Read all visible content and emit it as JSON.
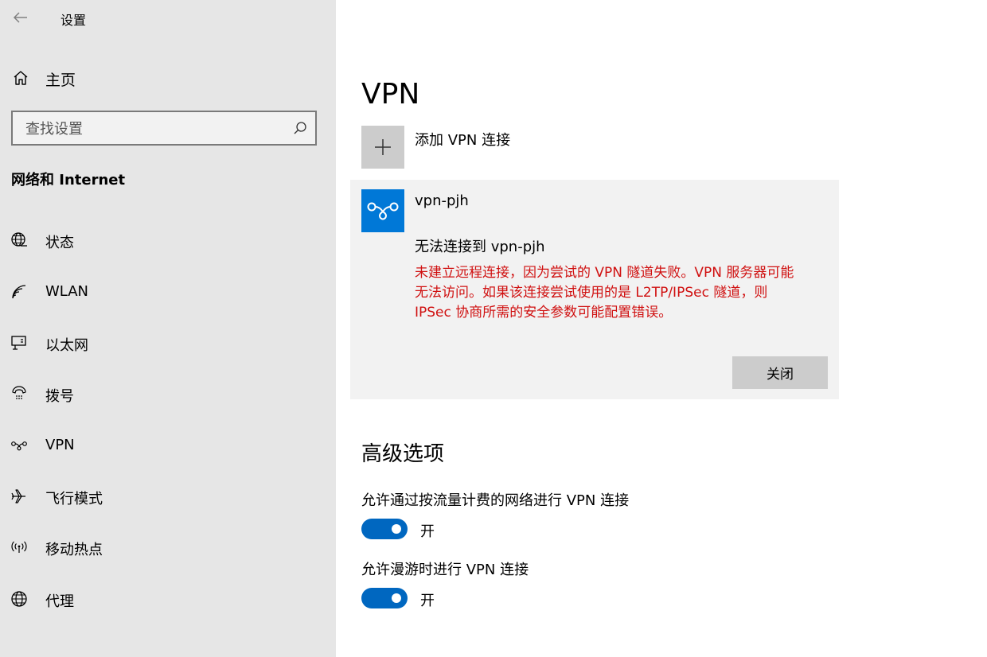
{
  "app": {
    "title": "设置"
  },
  "sidebar": {
    "home_label": "主页",
    "search_placeholder": "查找设置",
    "section_title": "网络和 Internet",
    "items": [
      {
        "label": "状态",
        "icon": "globe-status-icon"
      },
      {
        "label": "WLAN",
        "icon": "wifi-icon"
      },
      {
        "label": "以太网",
        "icon": "ethernet-icon"
      },
      {
        "label": "拨号",
        "icon": "dialup-icon"
      },
      {
        "label": "VPN",
        "icon": "vpn-icon"
      },
      {
        "label": "飞行模式",
        "icon": "airplane-icon"
      },
      {
        "label": "移动热点",
        "icon": "hotspot-icon"
      },
      {
        "label": "代理",
        "icon": "globe-icon"
      }
    ]
  },
  "main": {
    "title": "VPN",
    "add_vpn_label": "添加 VPN 连接",
    "vpn": {
      "name": "vpn-pjh",
      "status": "无法连接到 vpn-pjh",
      "error_lines": [
        "未建立远程连接，因为尝试的 VPN 隧道失败。VPN 服务器可能",
        "无法访问。如果该连接尝试使用的是 L2TP/IPSec 隧道，则",
        "IPSec 协商所需的安全参数可能配置错误。"
      ],
      "close_label": "关闭"
    },
    "advanced": {
      "title": "高级选项",
      "options": [
        {
          "label": "允许通过按流量计费的网络进行 VPN 连接",
          "state": "开",
          "on": true
        },
        {
          "label": "允许漫游时进行 VPN 连接",
          "state": "开",
          "on": true
        }
      ]
    }
  },
  "colors": {
    "sidebar_bg": "#e6e6e6",
    "accent": "#0067c0",
    "vpn_logo": "#0078d7",
    "error": "#d01010",
    "button_bg": "#cccccc"
  }
}
